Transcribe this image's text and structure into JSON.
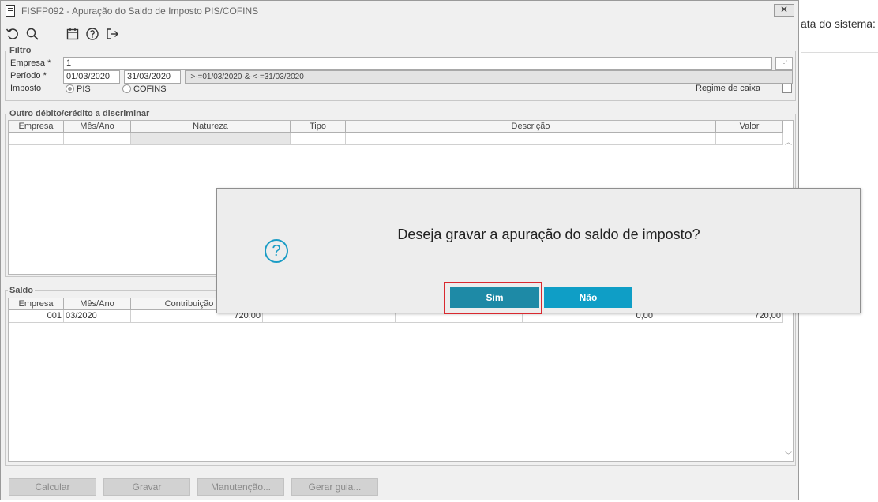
{
  "background_app": {
    "partial_text": "ata do sistema:"
  },
  "window": {
    "title": "FISFP092 - Apuração do Saldo de Imposto PIS/COFINS",
    "close_label": "✕"
  },
  "toolbar": {
    "icons": [
      "refresh-icon",
      "search-icon",
      "calendar-icon",
      "help-icon",
      "exit-icon"
    ]
  },
  "filtro": {
    "title": "Filtro",
    "empresa_label": "Empresa *",
    "empresa_value": "1",
    "periodo_label": "Período *",
    "periodo_start": "01/03/2020",
    "periodo_end": "31/03/2020",
    "periodo_expr": "·>·=01/03/2020·&·<·=31/03/2020",
    "imposto_label": "Imposto",
    "pis_label": "PIS",
    "cofins_label": "COFINS",
    "selected_imposto": "PIS",
    "regime_label": "Regime de caixa",
    "regime_checked": false
  },
  "outro": {
    "title": "Outro débito/crédito a discriminar",
    "columns": [
      "Empresa",
      "Mês/Ano",
      "Natureza",
      "Tipo",
      "Descrição",
      "Valor"
    ]
  },
  "saldo": {
    "title": "Saldo",
    "columns": [
      "Empresa",
      "Mês/Ano",
      "Contribuição por"
    ],
    "row": {
      "empresa": "001",
      "mes_ano": "03/2020",
      "contribuicao": "720,00",
      "col_x": "0,00",
      "col_last": "720,00"
    }
  },
  "buttons": {
    "calcular": "Calcular",
    "gravar": "Gravar",
    "manutencao": "Manutenção...",
    "gerar_guia": "Gerar guia..."
  },
  "dialog": {
    "message": "Deseja gravar a apuração do saldo de imposto?",
    "icon": "question-icon",
    "yes_label": "Sim",
    "no_label": "Não",
    "yes_color": "#1e8aa6",
    "no_color": "#0f9ec6",
    "highlight_color": "#d9292f"
  }
}
